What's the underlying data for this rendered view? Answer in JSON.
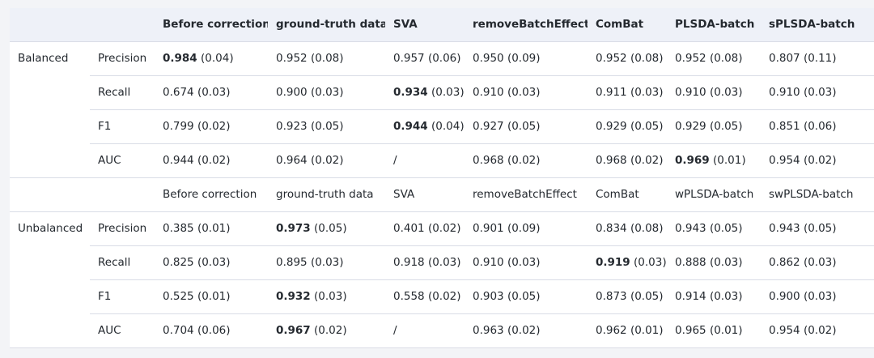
{
  "header": [
    "",
    "",
    "Before correction",
    "ground-truth data",
    "SVA",
    "removeBatchEffect",
    "ComBat",
    "PLSDA-batch",
    "sPLSDA-batch"
  ],
  "balanced": {
    "label": "Balanced",
    "rows": [
      {
        "metric": "Precision",
        "cells": [
          {
            "b": "0.984",
            "r": " (0.04)"
          },
          {
            "b": "",
            "r": "0.952 (0.08)"
          },
          {
            "b": "",
            "r": "0.957 (0.06)"
          },
          {
            "b": "",
            "r": "0.950 (0.09)"
          },
          {
            "b": "",
            "r": "0.952 (0.08)"
          },
          {
            "b": "",
            "r": "0.952 (0.08)"
          },
          {
            "b": "",
            "r": "0.807 (0.11)"
          }
        ]
      },
      {
        "metric": "Recall",
        "cells": [
          {
            "b": "",
            "r": "0.674 (0.03)"
          },
          {
            "b": "",
            "r": "0.900 (0.03)"
          },
          {
            "b": "0.934",
            "r": " (0.03)"
          },
          {
            "b": "",
            "r": "0.910 (0.03)"
          },
          {
            "b": "",
            "r": "0.911 (0.03)"
          },
          {
            "b": "",
            "r": "0.910 (0.03)"
          },
          {
            "b": "",
            "r": "0.910 (0.03)"
          }
        ]
      },
      {
        "metric": "F1",
        "cells": [
          {
            "b": "",
            "r": "0.799 (0.02)"
          },
          {
            "b": "",
            "r": "0.923 (0.05)"
          },
          {
            "b": "0.944",
            "r": " (0.04)"
          },
          {
            "b": "",
            "r": "0.927 (0.05)"
          },
          {
            "b": "",
            "r": "0.929 (0.05)"
          },
          {
            "b": "",
            "r": "0.929 (0.05)"
          },
          {
            "b": "",
            "r": "0.851 (0.06)"
          }
        ]
      },
      {
        "metric": "AUC",
        "cells": [
          {
            "b": "",
            "r": "0.944 (0.02)"
          },
          {
            "b": "",
            "r": "0.964 (0.02)"
          },
          {
            "b": "",
            "r": "/"
          },
          {
            "b": "",
            "r": "0.968 (0.02)"
          },
          {
            "b": "",
            "r": "0.968 (0.02)"
          },
          {
            "b": "0.969",
            "r": " (0.01)"
          },
          {
            "b": "",
            "r": "0.954 (0.02)"
          }
        ]
      }
    ]
  },
  "subheader": [
    "",
    "",
    "Before correction",
    "ground-truth data",
    "SVA",
    "removeBatchEffect",
    "ComBat",
    "wPLSDA-batch",
    "swPLSDA-batch"
  ],
  "unbalanced": {
    "label": "Unbalanced",
    "rows": [
      {
        "metric": "Precision",
        "cells": [
          {
            "b": "",
            "r": "0.385 (0.01)"
          },
          {
            "b": "0.973",
            "r": " (0.05)"
          },
          {
            "b": "",
            "r": "0.401 (0.02)"
          },
          {
            "b": "",
            "r": "0.901 (0.09)"
          },
          {
            "b": "",
            "r": "0.834 (0.08)"
          },
          {
            "b": "",
            "r": "0.943 (0.05)"
          },
          {
            "b": "",
            "r": "0.943 (0.05)"
          }
        ]
      },
      {
        "metric": "Recall",
        "cells": [
          {
            "b": "",
            "r": "0.825 (0.03)"
          },
          {
            "b": "",
            "r": "0.895 (0.03)"
          },
          {
            "b": "",
            "r": "0.918 (0.03)"
          },
          {
            "b": "",
            "r": "0.910 (0.03)"
          },
          {
            "b": "0.919",
            "r": " (0.03)"
          },
          {
            "b": "",
            "r": "0.888 (0.03)"
          },
          {
            "b": "",
            "r": "0.862 (0.03)"
          }
        ]
      },
      {
        "metric": "F1",
        "cells": [
          {
            "b": "",
            "r": "0.525 (0.01)"
          },
          {
            "b": "0.932",
            "r": " (0.03)"
          },
          {
            "b": "",
            "r": "0.558 (0.02)"
          },
          {
            "b": "",
            "r": "0.903 (0.05)"
          },
          {
            "b": "",
            "r": "0.873 (0.05)"
          },
          {
            "b": "",
            "r": "0.914 (0.03)"
          },
          {
            "b": "",
            "r": "0.900 (0.03)"
          }
        ]
      },
      {
        "metric": "AUC",
        "cells": [
          {
            "b": "",
            "r": "0.704 (0.06)"
          },
          {
            "b": "0.967",
            "r": " (0.02)"
          },
          {
            "b": "",
            "r": "/"
          },
          {
            "b": "",
            "r": "0.963 (0.02)"
          },
          {
            "b": "",
            "r": "0.962 (0.01)"
          },
          {
            "b": "",
            "r": "0.965 (0.01)"
          },
          {
            "b": "",
            "r": "0.954 (0.02)"
          }
        ]
      }
    ]
  }
}
